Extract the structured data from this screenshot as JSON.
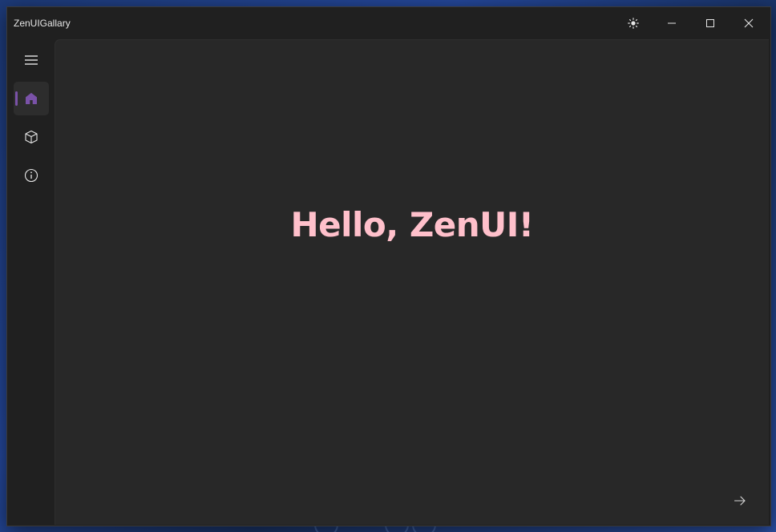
{
  "window": {
    "title": "ZenUIGallary"
  },
  "titlebar": {
    "buttons": [
      "theme-toggle",
      "minimize",
      "maximize",
      "close"
    ]
  },
  "sidebar": {
    "items": [
      {
        "name": "menu",
        "icon": "hamburger-icon",
        "selected": false
      },
      {
        "name": "home",
        "icon": "home-icon",
        "selected": true
      },
      {
        "name": "components",
        "icon": "cube-icon",
        "selected": false
      },
      {
        "name": "about",
        "icon": "info-icon",
        "selected": false
      }
    ]
  },
  "main": {
    "greeting": "Hello, ZenUI!",
    "next_icon": "arrow-right-icon"
  },
  "colors": {
    "greeting": "#ffc0cb",
    "accent": "#7a52a8",
    "window_bg": "#202020",
    "content_bg": "#282828"
  }
}
